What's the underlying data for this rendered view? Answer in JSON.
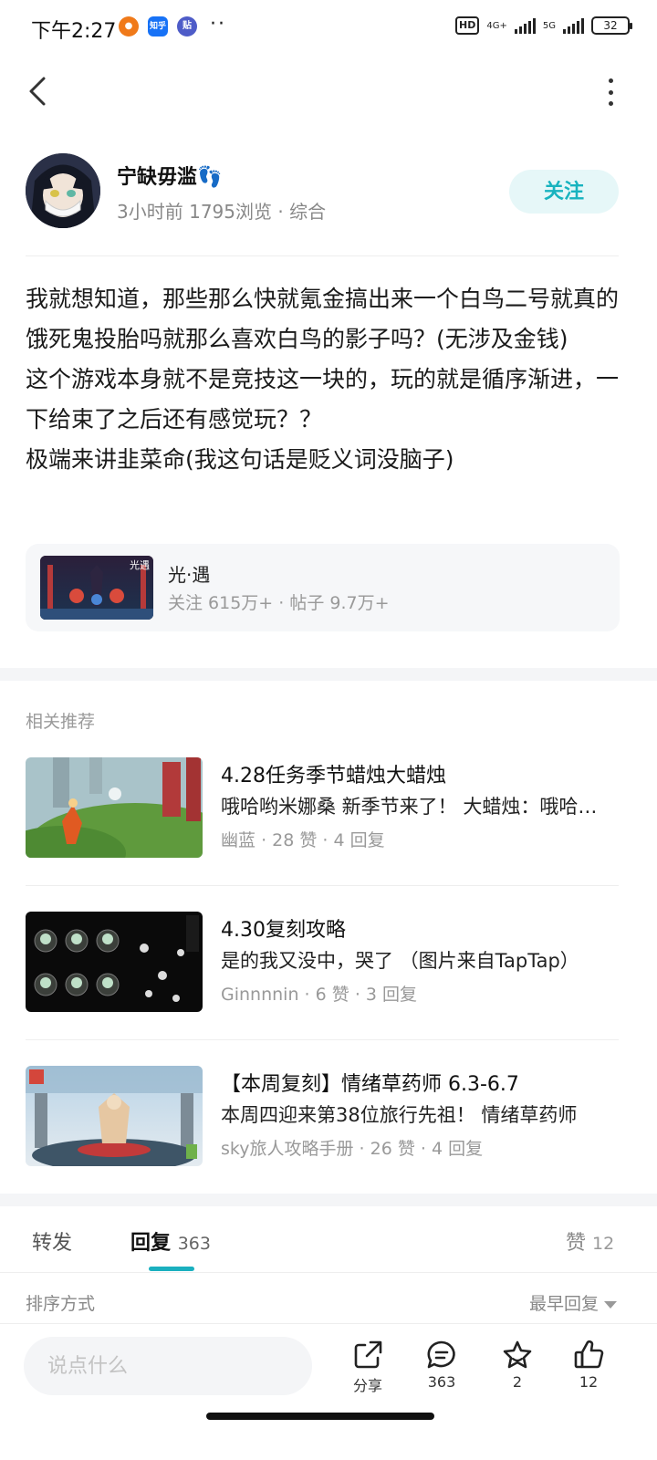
{
  "status_bar": {
    "time": "下午2:27",
    "network_1": "4G+",
    "network_2": "5G",
    "hd_badge": "HD",
    "battery": "32",
    "app_badges": [
      "知乎",
      "贴"
    ]
  },
  "post": {
    "author": {
      "name": "宁缺毋滥👣",
      "time_ago": "3小时前",
      "views": "1795浏览",
      "category": "综合",
      "follow_label": "关注"
    },
    "paragraphs": [
      "我就想知道，那些那么快就氪金搞出来一个白鸟二号就真的饿死鬼投胎吗就那么喜欢白鸟的影子吗？(无涉及金钱)",
      "这个游戏本身就不是竞技这一块的，玩的就是循序渐进，一下给束了之后还有感觉玩？？",
      "极端来讲韭菜命(我这句话是贬义词没脑子)"
    ],
    "forum": {
      "name": "光·遇",
      "followers": "关注 615万+",
      "posts": "帖子 9.7万+",
      "thumb_text": "光遇"
    }
  },
  "related": {
    "title": "相关推荐",
    "items": [
      {
        "title": "4.28任务季节蜡烛大蜡烛",
        "subtitle": "哦哈哟米娜桑 新季节来了！ 大蜡烛：哦哈哟米娜桑 新季节来了！",
        "author": "幽蓝",
        "likes": "28 赞",
        "replies": "4 回复"
      },
      {
        "title": "4.30复刻攻略",
        "subtitle": "是的我又没中，哭了 （图片来自TapTap）",
        "author": "Ginnnnin",
        "likes": "6 赞",
        "replies": "3 回复"
      },
      {
        "title": "【本周复刻】情绪草药师 6.3-6.7",
        "subtitle": "本周四迎来第38位旅行先祖！ 情绪草药师",
        "author": "sky旅人攻略手册",
        "likes": "26 赞",
        "replies": "4 回复"
      }
    ]
  },
  "tabs": {
    "forward": "转发",
    "reply": "回复",
    "reply_count": "363",
    "like": "赞",
    "like_count": "12"
  },
  "sort": {
    "label": "排序方式",
    "value": "最早回复"
  },
  "bottom_bar": {
    "input_placeholder": "说点什么",
    "share_label": "分享",
    "comment_count": "363",
    "favorite_count": "2",
    "like_count": "12"
  },
  "colors": {
    "accent": "#1ab0bf",
    "follow_bg": "#e6f7f8",
    "card_bg": "#f6f7f9",
    "muted_text": "#999999"
  },
  "icons": [
    "back-icon",
    "more-icon",
    "share-icon",
    "comment-icon",
    "star-icon",
    "thumbs-up-icon",
    "caret-down-icon",
    "footprints-icon"
  ]
}
